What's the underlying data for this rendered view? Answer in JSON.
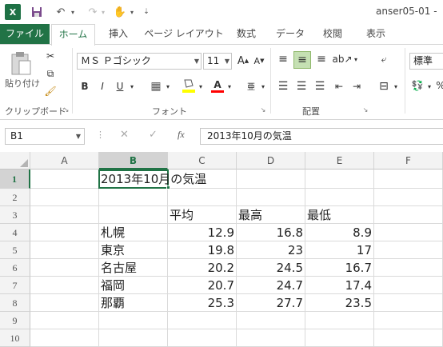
{
  "app": {
    "logo": "X",
    "document_title": "anser05-01 -"
  },
  "tabs": [
    "ファイル",
    "ホーム",
    "挿入",
    "ページ レイアウト",
    "数式",
    "データ",
    "校閲",
    "表示"
  ],
  "ribbon": {
    "clipboard": {
      "paste_label": "貼り付け",
      "group_label": "クリップボード"
    },
    "font": {
      "font_name": "ＭＳ Ｐゴシック",
      "font_size": "11",
      "group_label": "フォント",
      "bold": "B",
      "italic": "I",
      "underline": "U",
      "highlight_color": "#ffff00",
      "font_color": "#ff0000"
    },
    "alignment": {
      "group_label": "配置"
    },
    "number": {
      "format": "標準"
    }
  },
  "formula_bar": {
    "name_box": "B1",
    "fx": "fx",
    "content": "2013年10月の気温"
  },
  "columns": [
    "A",
    "B",
    "C",
    "D",
    "E",
    "F"
  ],
  "rows": [
    "1",
    "2",
    "3",
    "4",
    "5",
    "6",
    "7",
    "8",
    "9",
    "10"
  ],
  "sheet": {
    "title": "2013年10月の気温",
    "headers": [
      "平均",
      "最高",
      "最低"
    ],
    "data": [
      {
        "city": "札幌",
        "avg": "12.9",
        "max": "16.8",
        "min": "8.9"
      },
      {
        "city": "東京",
        "avg": "19.8",
        "max": "23",
        "min": "17"
      },
      {
        "city": "名古屋",
        "avg": "20.2",
        "max": "24.5",
        "min": "16.7"
      },
      {
        "city": "福岡",
        "avg": "20.7",
        "max": "24.7",
        "min": "17.4"
      },
      {
        "city": "那覇",
        "avg": "25.3",
        "max": "27.7",
        "min": "23.5"
      }
    ]
  },
  "colors": {
    "excel_green": "#217346",
    "selection": "#217346"
  }
}
